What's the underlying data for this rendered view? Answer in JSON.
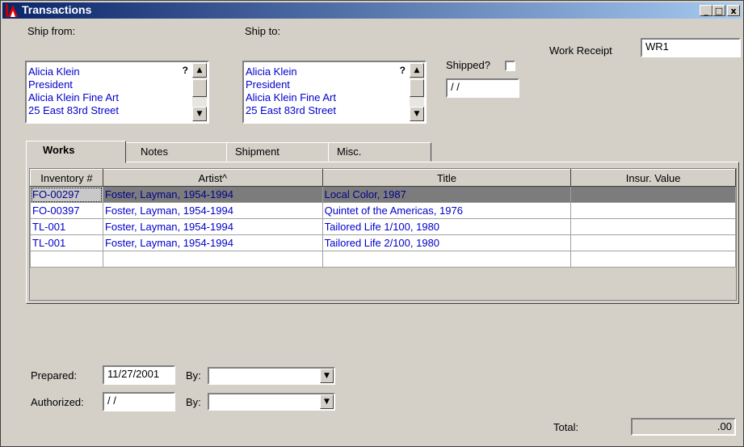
{
  "window": {
    "title": "Transactions",
    "controls": {
      "minimize": "_",
      "maximize": "□",
      "close": "x"
    }
  },
  "ship_from": {
    "label": "Ship from:",
    "lines": [
      "Alicia Klein",
      "President",
      "Alicia Klein Fine Art",
      "25 East 83rd Street"
    ],
    "help": "?"
  },
  "ship_to": {
    "label": "Ship to:",
    "lines": [
      "Alicia Klein",
      "President",
      "Alicia Klein Fine Art",
      "25 East 83rd Street"
    ],
    "help": "?"
  },
  "shipped": {
    "label": "Shipped?",
    "checked": false,
    "date": " / /"
  },
  "work_receipt": {
    "label": "Work Receipt",
    "value": "WR1"
  },
  "tabs": [
    {
      "label": "Works",
      "active": true
    },
    {
      "label": "Notes",
      "active": false
    },
    {
      "label": "Shipment",
      "active": false
    },
    {
      "label": "Misc.",
      "active": false
    }
  ],
  "grid": {
    "headers": [
      "Inventory #",
      "Artist^",
      "Title",
      "Insur. Value"
    ],
    "rows": [
      {
        "inventory": "FO-00297",
        "artist": "Foster, Layman, 1954-1994",
        "title": "Local Color, 1987",
        "value": "",
        "selected": true
      },
      {
        "inventory": "FO-00397",
        "artist": "Foster, Layman, 1954-1994",
        "title": "Quintet of the Americas, 1976",
        "value": ""
      },
      {
        "inventory": "TL-001",
        "artist": "Foster, Layman, 1954-1994",
        "title": "Tailored Life 1/100, 1980",
        "value": ""
      },
      {
        "inventory": "TL-001",
        "artist": "Foster, Layman, 1954-1994",
        "title": "Tailored Life 2/100, 1980",
        "value": ""
      },
      {
        "inventory": "",
        "artist": "",
        "title": "",
        "value": ""
      }
    ]
  },
  "prepared": {
    "label": "Prepared:",
    "date": "11/27/2001",
    "by_label": "By:",
    "by_value": ""
  },
  "authorized": {
    "label": "Authorized:",
    "date": " / /",
    "by_label": "By:",
    "by_value": ""
  },
  "total": {
    "label": "Total:",
    "value": ".00"
  }
}
